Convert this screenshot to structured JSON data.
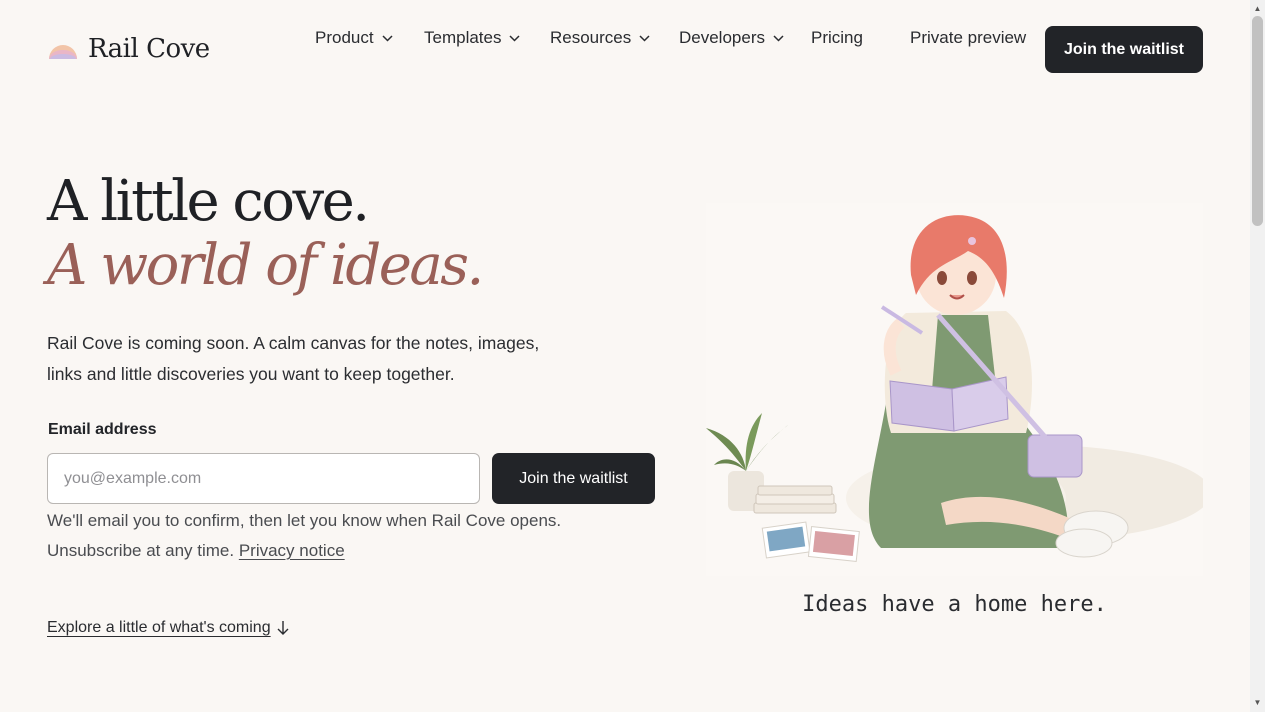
{
  "header": {
    "brand": "Rail Cove",
    "nav": [
      {
        "label": "Product",
        "dropdown": true
      },
      {
        "label": "Templates",
        "dropdown": true
      },
      {
        "label": "Resources",
        "dropdown": true
      },
      {
        "label": "Developers",
        "dropdown": true
      },
      {
        "label": "Pricing",
        "dropdown": false
      },
      {
        "label": "Private preview",
        "dropdown": false
      }
    ],
    "cta": "Join the waitlist"
  },
  "hero": {
    "headline_1": "A little cove.",
    "headline_2": "A world of ideas.",
    "lede": "Rail Cove is coming soon. A calm canvas for the notes, images, links and little discoveries you want to keep together.",
    "email_label": "Email address",
    "email_placeholder": "you@example.com",
    "email_value": "",
    "submit": "Join the waitlist",
    "note": "We'll email you to confirm, then let you know when Rail Cove opens. Unsubscribe at any time.",
    "privacy_link": "Privacy notice",
    "explore": "Explore a little of what's coming"
  },
  "illustration": {
    "caption": "Ideas have a home here.",
    "icon": "illustration-girl-reading"
  },
  "colors": {
    "accent": "#9a6058",
    "dark": "#222428",
    "background": "#faf7f4"
  }
}
